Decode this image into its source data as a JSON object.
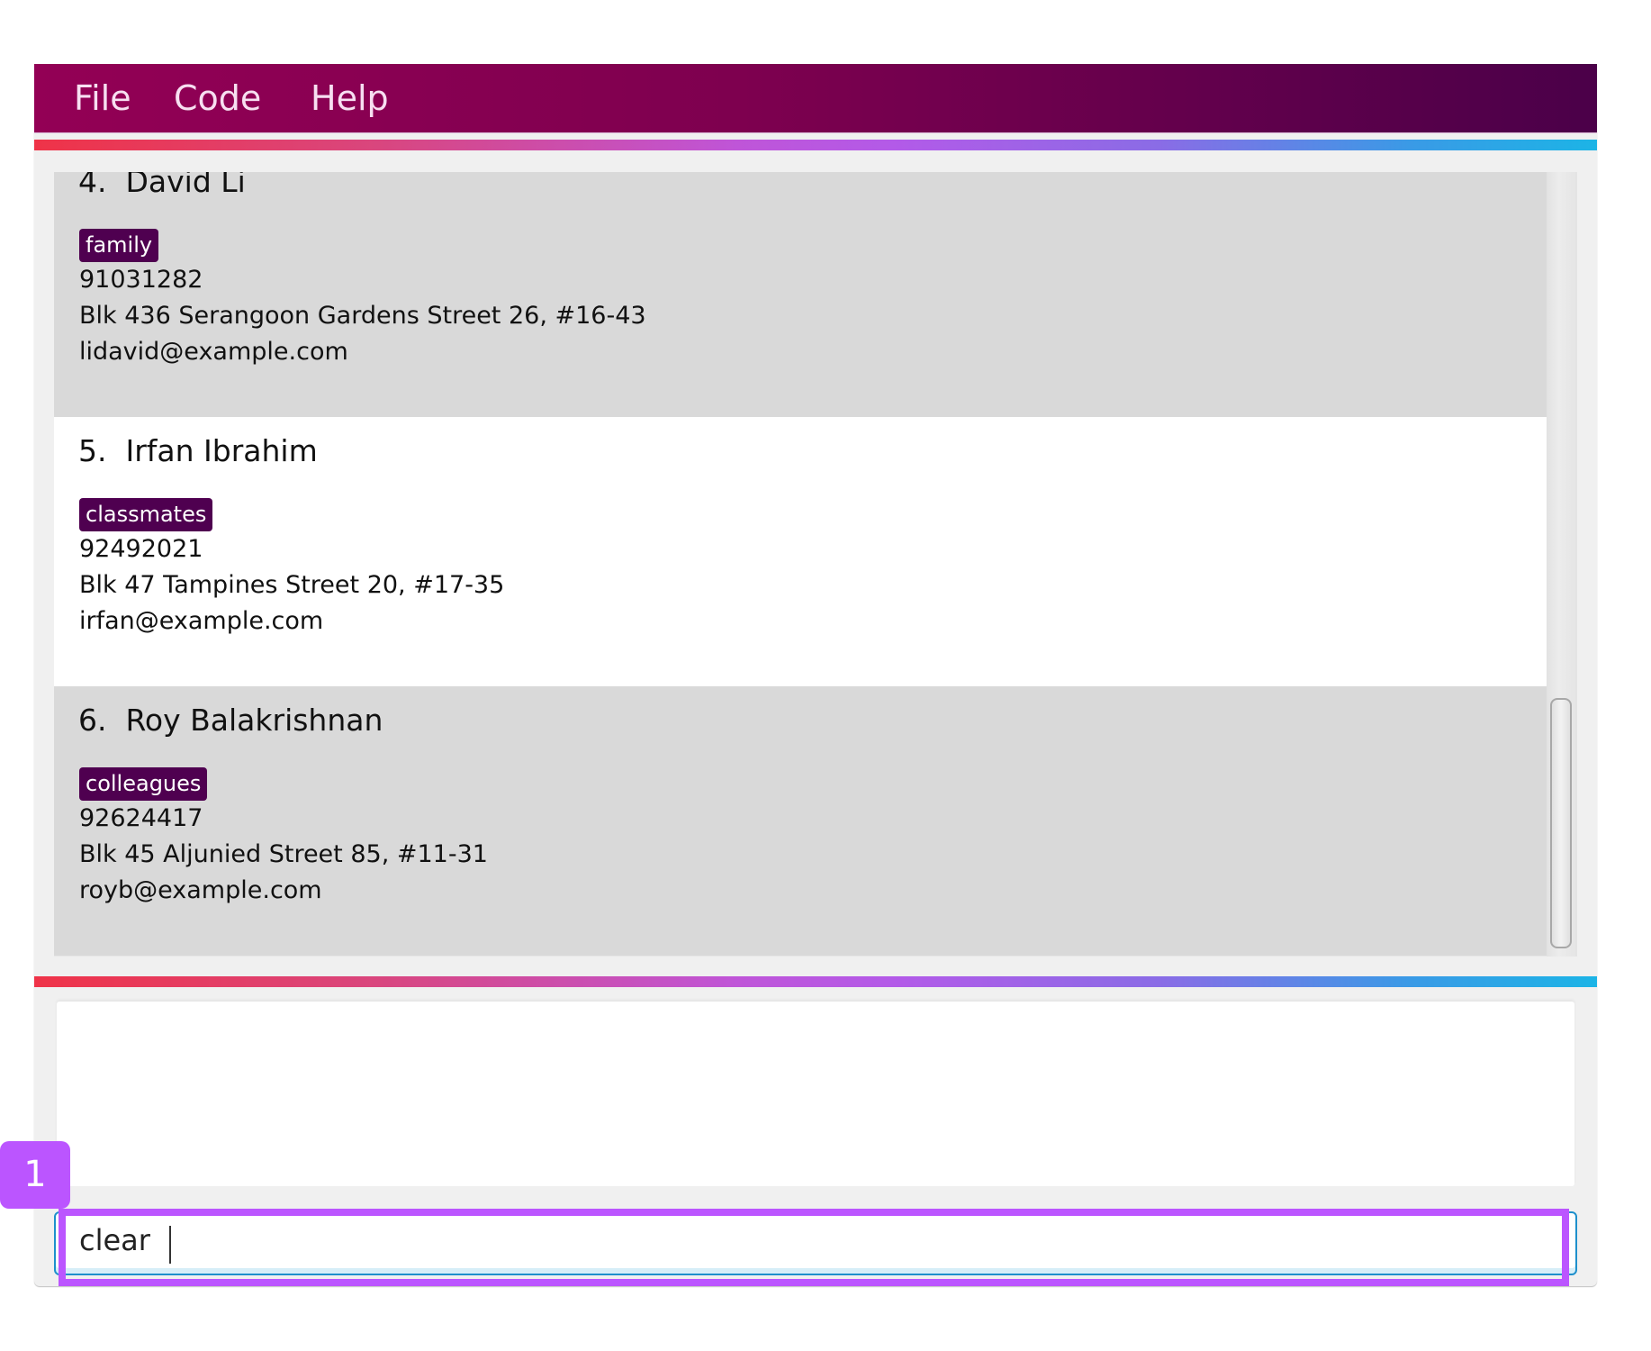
{
  "menu": {
    "items": [
      {
        "label": "File"
      },
      {
        "label": "Code"
      },
      {
        "label": "Help"
      }
    ]
  },
  "colors": {
    "menu_gradient_start": "#930055",
    "menu_gradient_end": "#4b0049",
    "tag_background": "#4f0050",
    "divider_start": "#ef3348",
    "divider_mid": "#b35ae8",
    "divider_end": "#1cb4e6",
    "annotation": "#bb55ff"
  },
  "person_list": {
    "persons": [
      {
        "index": "4.",
        "name": "David Li",
        "tags": [
          "family"
        ],
        "phone": "91031282",
        "address": "Blk 436 Serangoon Gardens Street 26, #16-43",
        "email": "lidavid@example.com"
      },
      {
        "index": "5.",
        "name": "Irfan Ibrahim",
        "tags": [
          "classmates"
        ],
        "phone": "92492021",
        "address": "Blk 47 Tampines Street 20, #17-35",
        "email": "irfan@example.com"
      },
      {
        "index": "6.",
        "name": "Roy Balakrishnan",
        "tags": [
          "colleagues"
        ],
        "phone": "92624417",
        "address": "Blk 45 Aljunied Street 85, #11-31",
        "email": "royb@example.com"
      }
    ]
  },
  "result_display": {
    "text": ""
  },
  "command_box": {
    "value": "clear",
    "placeholder": ""
  },
  "annotation": {
    "step_number": "1"
  }
}
